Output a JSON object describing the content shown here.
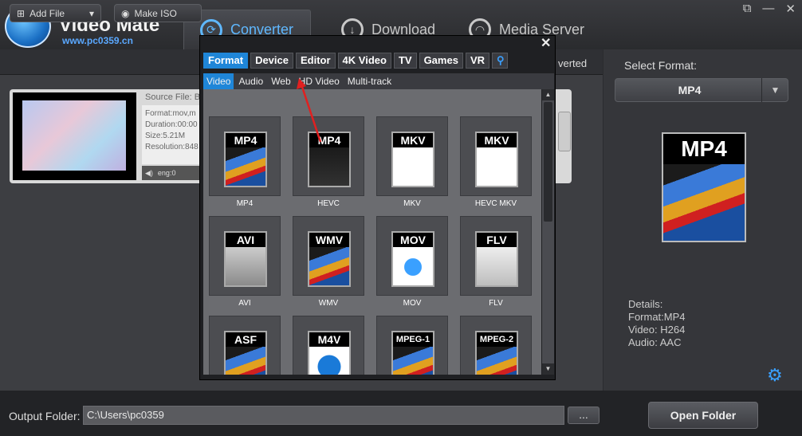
{
  "app": {
    "title": "Video Mate",
    "watermark": "www.pc0359.cn"
  },
  "tabs": [
    {
      "label": "Converter"
    },
    {
      "label": "Download"
    },
    {
      "label": "Media Server"
    }
  ],
  "toolbar": {
    "add_file": "Add File",
    "make_iso": "Make ISO",
    "converted": "verted"
  },
  "item": {
    "source_file": "Source File: B",
    "info_lines": [
      "Format:mov,m",
      "Duration:00:00",
      "Size:5.21M",
      "Resolution:848"
    ],
    "audio_track": "eng:0"
  },
  "right": {
    "select_format_label": "Select Format:",
    "selected_format": "MP4",
    "big_icon_label": "MP4",
    "details": {
      "title": "Details:",
      "format": "Format:MP4",
      "video": "Video: H264",
      "audio": "Audio: AAC"
    }
  },
  "bottom": {
    "output_label": "Output Folder:",
    "output_path": "C:\\Users\\pc0359",
    "browse": "...",
    "open_folder": "Open Folder"
  },
  "popup": {
    "categories": [
      "Format",
      "Device",
      "Editor",
      "4K Video",
      "TV",
      "Games",
      "VR"
    ],
    "subtabs": [
      "Video",
      "Audio",
      "Web",
      "HD Video",
      "Multi-track"
    ],
    "formats": [
      {
        "icon": "MP4",
        "name": "MP4"
      },
      {
        "icon": "MP4",
        "name": "HEVC"
      },
      {
        "icon": "MKV",
        "name": "MKV"
      },
      {
        "icon": "MKV",
        "name": "HEVC MKV"
      },
      {
        "icon": "AVI",
        "name": "AVI"
      },
      {
        "icon": "WMV",
        "name": "WMV"
      },
      {
        "icon": "MOV",
        "name": "MOV"
      },
      {
        "icon": "FLV",
        "name": "FLV"
      },
      {
        "icon": "ASF",
        "name": ""
      },
      {
        "icon": "M4V",
        "name": ""
      },
      {
        "icon": "MPEG-1",
        "name": ""
      },
      {
        "icon": "MPEG-2",
        "name": ""
      }
    ]
  },
  "colors": {
    "accent": "#1f86d8",
    "converter_tab": "#5fb8ff",
    "annotation": "#e02020"
  }
}
